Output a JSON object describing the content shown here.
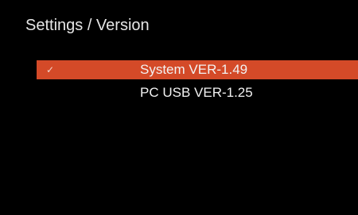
{
  "header": {
    "title": "Settings / Version"
  },
  "menu": {
    "items": [
      {
        "label": "System VER-1.49",
        "selected": true,
        "icon": "checkmark-icon"
      },
      {
        "label": "PC USB VER-1.25",
        "selected": false
      }
    ]
  },
  "colors": {
    "background": "#000000",
    "accent": "#d44a28",
    "text": "#f2f2f2"
  }
}
